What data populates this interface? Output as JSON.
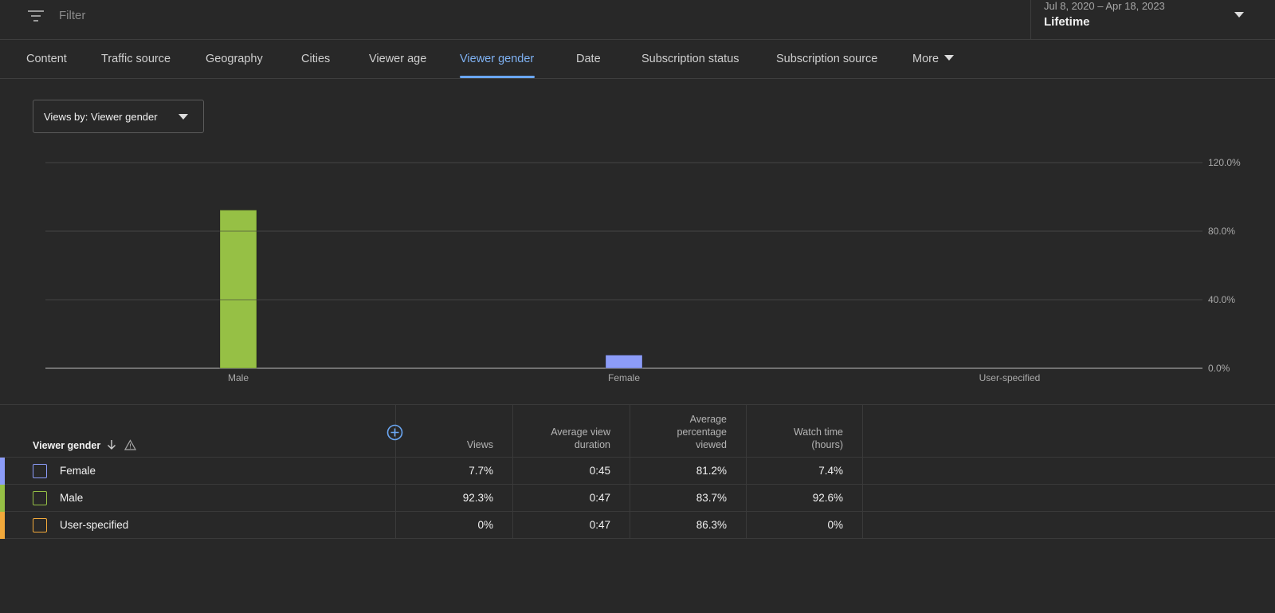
{
  "filter": {
    "placeholder": "Filter",
    "icon": "filter-icon"
  },
  "date_picker": {
    "range": "Jul 8, 2020 – Apr 18, 2023",
    "preset": "Lifetime"
  },
  "tabs": [
    {
      "label": "Content"
    },
    {
      "label": "Traffic source"
    },
    {
      "label": "Geography"
    },
    {
      "label": "Cities"
    },
    {
      "label": "Viewer age"
    },
    {
      "label": "Viewer gender",
      "active": true
    },
    {
      "label": "Date"
    },
    {
      "label": "Subscription status"
    },
    {
      "label": "Subscription source"
    },
    {
      "label": "More"
    }
  ],
  "metric_select": {
    "label": "Views by: Viewer gender"
  },
  "chart_data": {
    "type": "bar",
    "categories": [
      "Male",
      "Female",
      "User-specified"
    ],
    "values": [
      92.3,
      7.7,
      0
    ],
    "colors": [
      "#96c045",
      "#8c9cf8",
      "#f2a93b"
    ],
    "ylim": [
      0,
      120
    ],
    "yticks": [
      "0.0%",
      "40.0%",
      "80.0%",
      "120.0%"
    ],
    "ytick_values": [
      0,
      40,
      80,
      120
    ],
    "grid": true,
    "y_axis_side": "right"
  },
  "table": {
    "dimension_header": "Viewer gender",
    "columns": [
      "Views",
      "Average view\nduration",
      "Average\npercentage\nviewed",
      "Watch time\n(hours)"
    ],
    "rows": [
      {
        "label": "Female",
        "color": "#8c9cf8",
        "cells": [
          "7.7%",
          "0:45",
          "81.2%",
          "7.4%"
        ]
      },
      {
        "label": "Male",
        "color": "#96c045",
        "cells": [
          "92.3%",
          "0:47",
          "83.7%",
          "92.6%"
        ]
      },
      {
        "label": "User-specified",
        "color": "#f2a93b",
        "cells": [
          "0%",
          "0:47",
          "86.3%",
          "0%"
        ]
      }
    ]
  }
}
